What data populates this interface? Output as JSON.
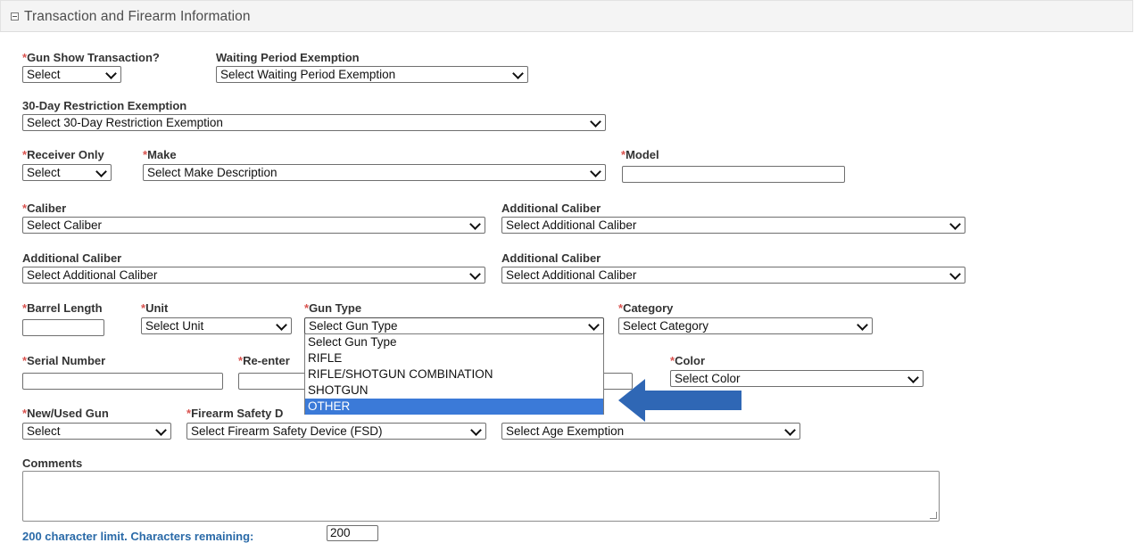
{
  "panel": {
    "title": "Transaction and Firearm Information"
  },
  "fields": {
    "gun_show": {
      "label": "Gun Show Transaction?",
      "required": "*",
      "value": "Select"
    },
    "waiting_period": {
      "label": "Waiting Period Exemption",
      "value": "Select Waiting Period Exemption"
    },
    "restriction_30day": {
      "label": "30-Day Restriction Exemption",
      "value": "Select 30-Day Restriction Exemption"
    },
    "receiver_only": {
      "label": "Receiver Only",
      "required": "*",
      "value": "Select"
    },
    "make": {
      "label": "Make",
      "required": "*",
      "value": "Select Make Description"
    },
    "model": {
      "label": "Model",
      "required": "*",
      "value": ""
    },
    "caliber": {
      "label": "Caliber",
      "required": "*",
      "value": "Select Caliber"
    },
    "additional_caliber_1": {
      "label": "Additional Caliber",
      "value": "Select Additional Caliber"
    },
    "additional_caliber_2": {
      "label": "Additional Caliber",
      "value": "Select Additional Caliber"
    },
    "additional_caliber_3": {
      "label": "Additional Caliber",
      "value": "Select Additional Caliber"
    },
    "barrel_length": {
      "label": "Barrel Length",
      "required": "*",
      "value": ""
    },
    "unit": {
      "label": "Unit",
      "required": "*",
      "value": "Select Unit"
    },
    "gun_type": {
      "label": "Gun Type",
      "required": "*",
      "value": "Select Gun Type"
    },
    "category": {
      "label": "Category",
      "required": "*",
      "value": "Select Category"
    },
    "serial_number": {
      "label": "Serial Number",
      "required": "*",
      "value": ""
    },
    "reenter_serial": {
      "label": "Re-enter",
      "required": "*",
      "value": ""
    },
    "color": {
      "label": "Color",
      "required": "*",
      "value": "Select Color"
    },
    "new_used": {
      "label": "New/Used Gun",
      "required": "*",
      "value": "Select"
    },
    "fsd": {
      "label": "Firearm Safety D",
      "required": "*",
      "value": "Select Firearm Safety Device (FSD)"
    },
    "age_exemption": {
      "label": "",
      "value": "Select Age Exemption"
    },
    "comments": {
      "label": "Comments",
      "value": ""
    }
  },
  "gun_type_options": [
    "Select Gun Type",
    "RIFLE",
    "RIFLE/SHOTGUN COMBINATION",
    "SHOTGUN",
    "OTHER"
  ],
  "gun_type_highlighted": "OTHER",
  "counter": {
    "label": "200 character limit. Characters remaining:",
    "value": "200"
  },
  "colors": {
    "accent_arrow": "#2f67b5",
    "highlight": "#3b7ad8",
    "required": "#d9534f",
    "counter_label": "#2a6aa8"
  },
  "icons": {
    "collapse": "minus-square-icon",
    "dropdown": "chevron-down-icon",
    "annotation": "arrow-left-icon"
  }
}
